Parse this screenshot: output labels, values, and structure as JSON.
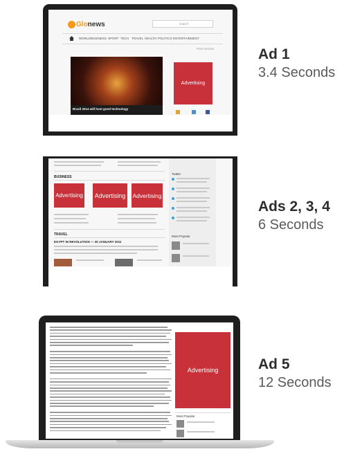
{
  "panels": [
    {
      "label_title": "Ad 1",
      "label_time": "3.4 Seconds",
      "site": {
        "logo_prefix": "Glo",
        "logo_suffix": "news",
        "search_placeholder": "search",
        "nav": [
          "WORLD",
          "BUSINESS",
          "SPORT",
          "TECH",
          "TRAVEL",
          "HEALTH",
          "POLITICS",
          "ENTERTAINMENT"
        ],
        "crumb": "Print Version",
        "ad_label": "Advertising",
        "hero_caption": "Brazil 2014 will host good technology"
      }
    },
    {
      "label_title": "Ads 2, 3, 4",
      "label_time": "6 Seconds",
      "site": {
        "section_business": "BUSINESS",
        "ad_labels": [
          "Advertising",
          "Advertising",
          "Advertising"
        ],
        "section_travel": "TRAVEL",
        "travel_headline": "EGYPT IN REVOLUTION — 30 JANUARY 2011",
        "sidebar_twitter": "Twitter",
        "sidebar_popular": "Most Popular"
      }
    },
    {
      "label_title": "Ad 5",
      "label_time": "12 Seconds",
      "site": {
        "ad_label": "Advertising",
        "sidebar_popular": "Most Popular"
      }
    }
  ]
}
